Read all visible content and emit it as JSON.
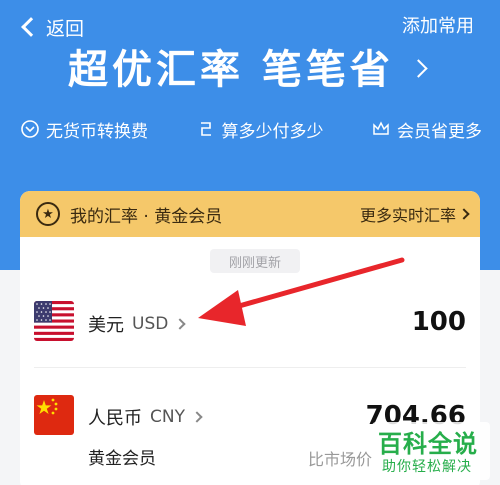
{
  "nav": {
    "back_label": "返回",
    "add_label": "添加常用"
  },
  "hero": {
    "headline": "超优汇率 笔笔省"
  },
  "features": [
    {
      "icon": "coin-icon",
      "label": "无货币转换费"
    },
    {
      "icon": "exchange-icon",
      "label": "算多少付多少"
    },
    {
      "icon": "crown-icon",
      "label": "会员省更多"
    }
  ],
  "card": {
    "title": "我的汇率 · 黄金会员",
    "more_label": "更多实时汇率",
    "updated_label": "刚刚更新",
    "rows": [
      {
        "flag": "us-flag",
        "name": "美元",
        "code": "USD",
        "amount": "100"
      },
      {
        "flag": "cn-flag",
        "name": "人民币",
        "code": "CNY",
        "amount": "704.66"
      }
    ],
    "member_label": "黄金会员",
    "market_label": "比市场价"
  },
  "watermark": {
    "main": "百科全说",
    "sub": "助你轻松解决"
  },
  "colors": {
    "hero_blue": "#3d8ee8",
    "gold": "#f5c86a",
    "annotation_red": "#e8262b",
    "watermark_green": "#27ae4b"
  }
}
